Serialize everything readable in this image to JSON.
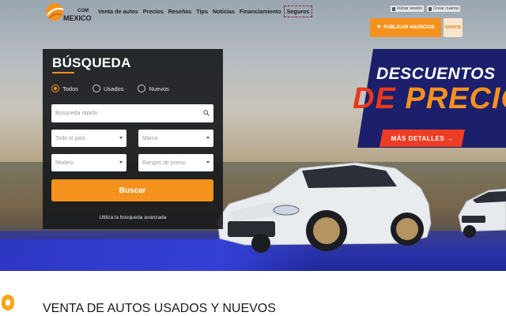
{
  "header": {
    "logo_com": "COM",
    "logo_text": "MEXICO",
    "nav": [
      "Venta de autos",
      "Precios",
      "Reseñas",
      "Tips",
      "Noticias",
      "Financiamiento",
      "Seguros"
    ],
    "login_label": "Iniciar sesión",
    "register_label": "Crear cuenta",
    "publish_label": "PUBLICAR ANUNCIOS",
    "gratis_label": "GRATIS"
  },
  "search": {
    "title": "BÚSQUEDA",
    "radios": [
      {
        "label": "Todos",
        "checked": true
      },
      {
        "label": "Usados",
        "checked": false
      },
      {
        "label": "Nuevos",
        "checked": false
      }
    ],
    "quick_placeholder": "Búsqueda rápida",
    "country_value": "Todo el país",
    "brand_value": "Marca",
    "model_value": "Modelo",
    "price_value": "Rangos de precio",
    "button_label": "Buscar",
    "advanced_link": "Utiliza la búsqueda avanzada"
  },
  "promo": {
    "line1": "DESCUENTOS",
    "line2_a": "DE",
    "line2_b": "PRECIO",
    "button_label": "MÁS DETALLES →"
  },
  "main": {
    "section_title": "VENTA DE AUTOS USADOS Y NUEVOS"
  },
  "colors": {
    "accent": "#f5921e",
    "promo_bg": "#1c1f6b",
    "promo_red": "#ee3d24"
  }
}
